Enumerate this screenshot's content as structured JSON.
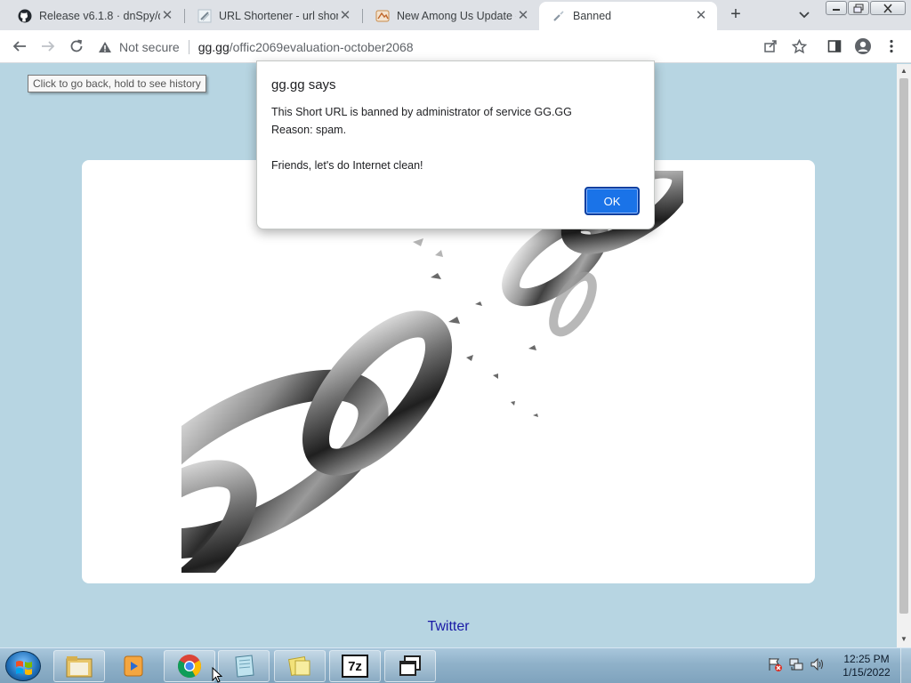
{
  "browser": {
    "tabs": [
      {
        "title": "Release v6.1.8 · dnSpy/dn",
        "favicon": "github-icon",
        "active": false
      },
      {
        "title": "URL Shortener - url short",
        "favicon": "chain-icon",
        "active": false
      },
      {
        "title": "New Among Us Update -",
        "favicon": "article-icon",
        "active": false
      },
      {
        "title": "Banned",
        "favicon": "chain-icon",
        "active": true
      }
    ],
    "new_tab_label": "+",
    "omnibox": {
      "security_label": "Not secure",
      "host": "gg.gg",
      "path": "/offic2069evaluation-october2068"
    },
    "back_tooltip": "Click to go back, hold to see history"
  },
  "dialog": {
    "title": "gg.gg says",
    "message": "This Short URL is banned by administrator of service GG.GG\nReason: spam.\n\nFriends, let's do Internet clean!",
    "ok_label": "OK"
  },
  "page": {
    "footer_link": "Twitter",
    "image_alt": "broken chain"
  },
  "taskbar": {
    "apps": [
      "file-explorer-icon",
      "media-player-icon",
      "chrome-icon",
      "notepad-icon",
      "folder-icon",
      "7zip-icon",
      "window-switcher-icon"
    ],
    "seven_zip_label": "7z",
    "clock_time": "12:25 PM",
    "clock_date": "1/15/2022"
  },
  "colors": {
    "page_bg": "#b7d5e2",
    "accent": "#1a73e8",
    "link": "#1a1aa6"
  }
}
